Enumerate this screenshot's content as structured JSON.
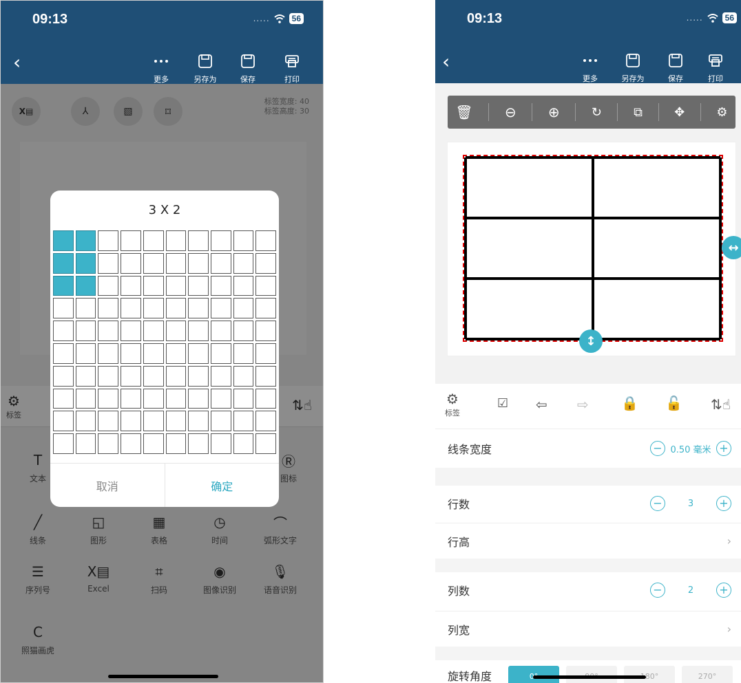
{
  "status": {
    "time": "09:13",
    "battery": "56"
  },
  "toolbar": {
    "more_label": "更多",
    "saveas_label": "另存为",
    "save_label": "保存",
    "print_label": "打印"
  },
  "left": {
    "label_width": "标签宽度: 40",
    "label_height": "标签高度: 30",
    "settings_label": "标签",
    "dialog": {
      "title": "3 X 2",
      "rows": 10,
      "cols": 10,
      "selected_rows": 3,
      "selected_cols": 2,
      "cancel_label": "取消",
      "confirm_label": "确定"
    },
    "tools": [
      {
        "label": "文本",
        "icon": "text-icon"
      },
      {
        "label": "图标",
        "icon": "icon-r-icon"
      },
      {
        "label": "线条",
        "icon": "line-icon"
      },
      {
        "label": "图形",
        "icon": "shape-icon"
      },
      {
        "label": "表格",
        "icon": "table-icon"
      },
      {
        "label": "时间",
        "icon": "clock-icon"
      },
      {
        "label": "弧形文字",
        "icon": "arc-text-icon"
      },
      {
        "label": "序列号",
        "icon": "serial-icon"
      },
      {
        "label": "Excel",
        "icon": "excel-icon"
      },
      {
        "label": "扫码",
        "icon": "scan-icon"
      },
      {
        "label": "图像识别",
        "icon": "image-recog-icon"
      },
      {
        "label": "语音识别",
        "icon": "mic-icon"
      },
      {
        "label": "照猫画虎",
        "icon": "copy-c-icon"
      }
    ]
  },
  "right": {
    "settings_label": "标签",
    "table": {
      "rows": 3,
      "cols": 2
    },
    "line_width": {
      "label": "线条宽度",
      "value": "0.50 毫米"
    },
    "row_count": {
      "label": "行数",
      "value": "3"
    },
    "row_height": {
      "label": "行高"
    },
    "col_count": {
      "label": "列数",
      "value": "2"
    },
    "col_width": {
      "label": "列宽"
    },
    "rotation": {
      "label": "旋转角度",
      "options": [
        "0°",
        "90°",
        "180°",
        "270°"
      ],
      "selected": "0°"
    }
  },
  "colors": {
    "nav": "#1f4f76",
    "accent": "#3cb3c9"
  }
}
